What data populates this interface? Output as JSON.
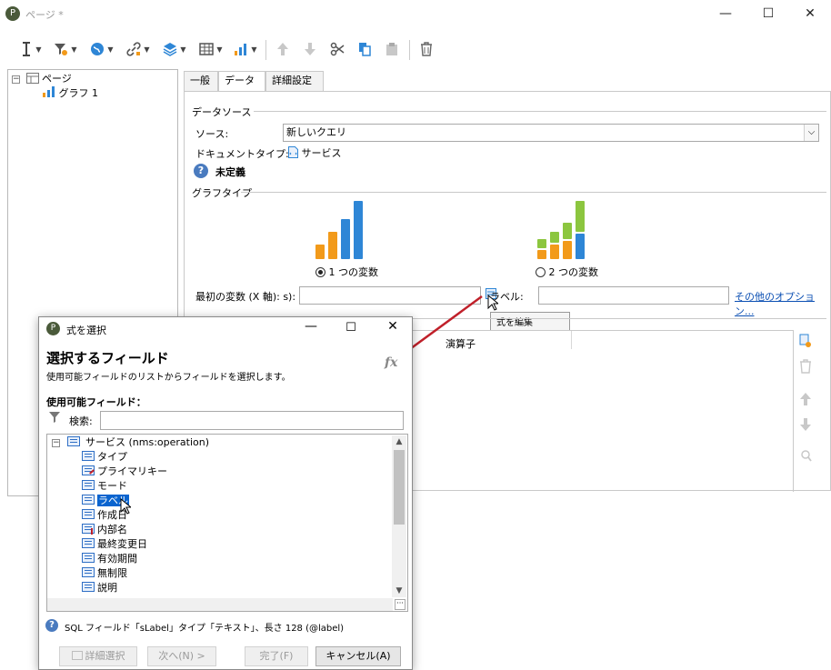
{
  "window": {
    "title": "ページ *",
    "minimize": "—",
    "maximize": "☐",
    "close": "✕"
  },
  "toolbar": {
    "icons": [
      "cursor-icon",
      "filter-icon",
      "globe-icon",
      "link-icon",
      "layers-icon",
      "table-icon",
      "chart-icon",
      "arrow-up-icon",
      "arrow-down-icon",
      "cut-icon",
      "copy-icon",
      "paste-icon",
      "trash-icon"
    ]
  },
  "tree": {
    "root_label": "ページ",
    "child_label": "グラフ 1"
  },
  "tabs": [
    {
      "label": "一般"
    },
    {
      "label": "データ"
    },
    {
      "label": "詳細設定"
    }
  ],
  "datasource": {
    "section_title": "データソース",
    "source_label": "ソース:",
    "source_value": "新しいクエリ",
    "doctype_label": "ドキュメントタイプ:",
    "doctype_value": "サービス",
    "undefined_label": "未定義"
  },
  "graphtype": {
    "section_title": "グラフタイプ",
    "option1_label": "1 つの変数",
    "option2_label": "2 つの変数",
    "selected": "1 つの変数"
  },
  "variable_row": {
    "first_var_label": "最初の変数 (X 軸): s):",
    "label_label": "ラベル:",
    "more_options_link": "その他のオプション...",
    "tooltip": "式を編集"
  },
  "series_header": {
    "operator": "演算子"
  },
  "dialog": {
    "title": "式を選択",
    "heading": "選択するフィールド",
    "subheading": "使用可能フィールドのリストからフィールドを選択します。",
    "fx_glyph": "fx",
    "available_fields_label": "使用可能フィールド：",
    "search_label": "検索:",
    "search_value": "",
    "tree_root": "サービス (nms:operation)",
    "fields": [
      {
        "label": "タイプ",
        "marker": ""
      },
      {
        "label": "プライマリキー",
        "marker": "key"
      },
      {
        "label": "モード",
        "marker": ""
      },
      {
        "label": "ラベル",
        "marker": "",
        "selected": true
      },
      {
        "label": "作成日",
        "marker": ""
      },
      {
        "label": "内部名",
        "marker": "required"
      },
      {
        "label": "最終変更日",
        "marker": ""
      },
      {
        "label": "有効期間",
        "marker": ""
      },
      {
        "label": "無制限",
        "marker": ""
      },
      {
        "label": "説明",
        "marker": ""
      }
    ],
    "status_text": "SQL フィールド「sLabel」タイプ「テキスト」、長さ 128 (@label)",
    "buttons": {
      "advanced": "詳細選択",
      "next": "次へ(N) >",
      "finish": "完了(F)",
      "cancel": "キャンセル(A)"
    }
  },
  "colors": {
    "bar_orange": "#f29a1a",
    "bar_blue": "#2e86d6",
    "bar_green": "#8cc63f",
    "arrow_red": "#c0202a",
    "selection_blue": "#0a64cf",
    "link_blue": "#0b4fb3"
  }
}
